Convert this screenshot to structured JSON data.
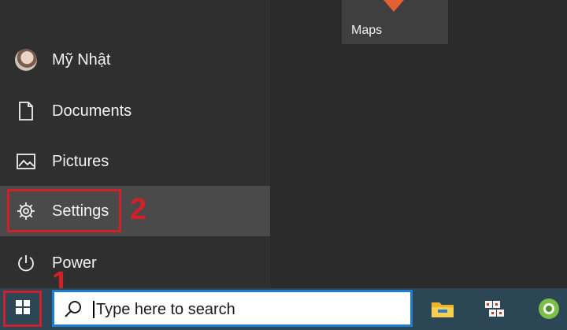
{
  "start_menu": {
    "tile": {
      "label": "Maps"
    },
    "items": [
      {
        "label": "Mỹ Nhật",
        "icon": "user-avatar"
      },
      {
        "label": "Documents",
        "icon": "document-icon"
      },
      {
        "label": "Pictures",
        "icon": "picture-icon"
      },
      {
        "label": "Settings",
        "icon": "gear-icon",
        "highlighted": true
      },
      {
        "label": "Power",
        "icon": "power-icon"
      }
    ]
  },
  "annotations": {
    "step1": "1",
    "step2": "2",
    "color": "#d0202a"
  },
  "taskbar": {
    "search_placeholder": "Type here to search",
    "apps": [
      "file-explorer-icon",
      "keyboard-app-icon",
      "coccoc-browser-icon"
    ]
  }
}
